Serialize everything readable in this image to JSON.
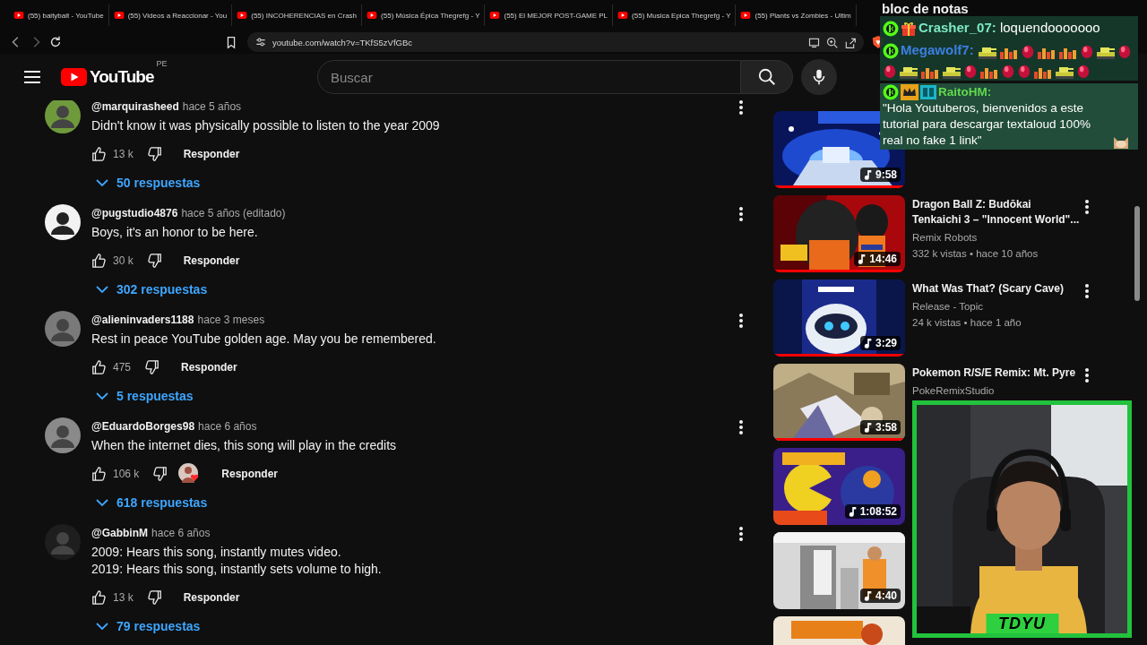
{
  "browser": {
    "tabs": [
      {
        "title": "(55) baitybait - YouTube"
      },
      {
        "title": "(55) Videos a Reaccionar - You"
      },
      {
        "title": "(55) INCOHERENCIAS en Crash"
      },
      {
        "title": "(55) Música Épica Thegrefg - Y"
      },
      {
        "title": "(55) El MEJOR POST-GAME PL"
      },
      {
        "title": "(55) Musica Epica Thegrefg - Y"
      },
      {
        "title": "(55) Plants vs Zombies - Ultim"
      }
    ],
    "url": "youtube.com/watch?v=TKfS5zVfGBc"
  },
  "header": {
    "logo_text": "YouTube",
    "country": "PE",
    "search": {
      "placeholder": "Buscar"
    }
  },
  "comments": [
    {
      "author": "@marquirasheed",
      "time": "hace 5 años",
      "text": "Didn't know it was physically possible to listen to the year 2009",
      "likes": "13 k",
      "reply": "Responder",
      "replies": "50 respuestas",
      "hearted": false
    },
    {
      "author": "@pugstudio4876",
      "time": "hace 5 años (editado)",
      "text": "Boys, it's an honor to be here.",
      "likes": "30 k",
      "reply": "Responder",
      "replies": "302 respuestas",
      "hearted": false
    },
    {
      "author": "@alieninvaders1188",
      "time": "hace 3 meses",
      "text": "Rest in peace YouTube golden age. May you be remembered.",
      "likes": "475",
      "reply": "Responder",
      "replies": "5 respuestas",
      "hearted": false
    },
    {
      "author": "@EduardoBorges98",
      "time": "hace 6 años",
      "text": "When the internet dies, this song will play in the credits",
      "likes": "106 k",
      "reply": "Responder",
      "replies": "618 respuestas",
      "hearted": true
    },
    {
      "author": "@GabbinM",
      "time": "hace 6 años",
      "text": "2009: Hears this song, instantly mutes video.\n2019: Hears this song, instantly sets volume to high.",
      "likes": "13 k",
      "reply": "Responder",
      "replies": "79 respuestas",
      "hearted": false
    }
  ],
  "related": [
    {
      "duration": "9:58",
      "level": 1
    },
    {
      "title": "Dragon Ball Z: Budōkai Tenkaichi 3 – \"Innocent World\"...",
      "channel": "Remix Robots",
      "views": "332 k vistas • hace 10 años",
      "duration": "14:46",
      "level": 1
    },
    {
      "title": "What Was That? (Scary Cave)",
      "channel": "Release - Topic",
      "views": "24 k vistas • hace 1 año",
      "duration": "3:29",
      "level": 1
    },
    {
      "title": "Pokemon R/S/E Remix: Mt. Pyre",
      "channel": "PokeRemixStudio",
      "duration": "3:58",
      "level": 1
    },
    {
      "duration": "1:08:52"
    },
    {
      "duration": "4:40"
    },
    {
      "kind": "picture"
    }
  ],
  "chat": {
    "title": "bloc de notas",
    "messages": [
      {
        "kind": "text",
        "user": "Crasher_07:",
        "color": "#7ee8c4",
        "text": "loquendooooooo"
      },
      {
        "kind": "emotes",
        "user": "Megawolf7:",
        "color": "#3b7fe0"
      },
      {
        "kind": "text-emote",
        "user": "RaitoHM:",
        "color": "#62d84e",
        "text": "\"Hola Youtuberos, bienvenidos a este tutorial para descargar textaloud 100% real no fake 1 link\""
      }
    ]
  },
  "webcam": {
    "label": "TDYU"
  }
}
